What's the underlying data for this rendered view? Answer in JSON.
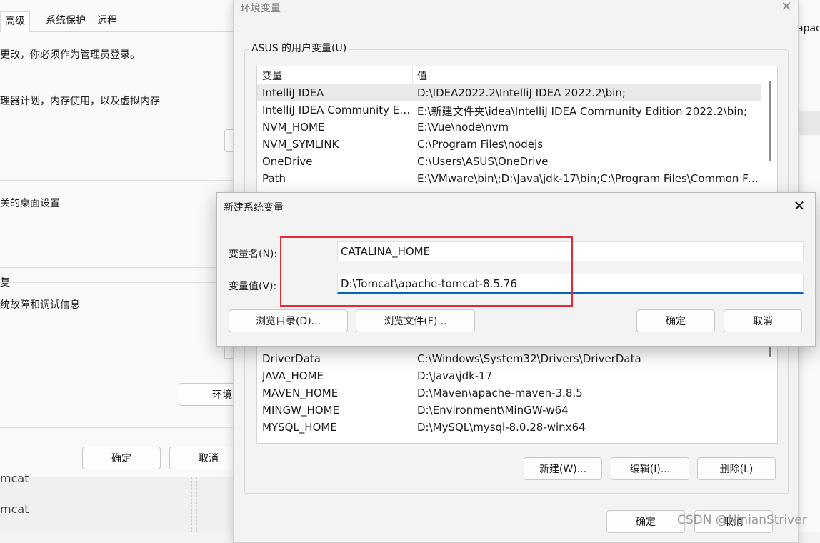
{
  "system_properties": {
    "tabs": [
      "高级",
      "系统保护",
      "远程"
    ],
    "admin_notice": "更改，你必须作为管理员登录。",
    "performance_desc": "理器计划，内存使用，以及虚拟内存",
    "profiles_desc": "关的桌面设置",
    "startup_heading": "复",
    "startup_desc": "统故障和调试信息",
    "env_button": "环境",
    "ok_button": "确定",
    "cancel_button": "取消"
  },
  "bottom_strip": {
    "line1": "mcat",
    "line2": "mcat"
  },
  "right_fragment": {
    "text": "apac"
  },
  "env_window": {
    "title": "环境变量",
    "user_group_label": "ASUS 的用户变量(U)",
    "columns": [
      "变量",
      "值"
    ],
    "user_vars": [
      {
        "name": "IntelliJ IDEA",
        "value": "D:\\IDEA2022.2\\IntelliJ IDEA 2022.2\\bin;"
      },
      {
        "name": "IntelliJ IDEA Community Ed...",
        "value": "E:\\新建文件夹\\idea\\IntelliJ IDEA Community Edition 2022.2\\bin;"
      },
      {
        "name": "NVM_HOME",
        "value": "E:\\Vue\\node\\nvm"
      },
      {
        "name": "NVM_SYMLINK",
        "value": "C:\\Program Files\\nodejs"
      },
      {
        "name": "OneDrive",
        "value": "C:\\Users\\ASUS\\OneDrive"
      },
      {
        "name": "Path",
        "value": "E:\\VMware\\bin\\;D:\\Java\\jdk-17\\bin;C:\\Program Files\\Common Fi..."
      }
    ],
    "system_vars": [
      {
        "name": "DriverData",
        "value": "C:\\Windows\\System32\\Drivers\\DriverData"
      },
      {
        "name": "JAVA_HOME",
        "value": "D:\\Java\\jdk-17"
      },
      {
        "name": "MAVEN_HOME",
        "value": "D:\\Maven\\apache-maven-3.8.5"
      },
      {
        "name": "MINGW_HOME",
        "value": "D:\\Environment\\MinGW-w64"
      },
      {
        "name": "MYSQL_HOME",
        "value": "D:\\MySQL\\mysql-8.0.28-winx64"
      }
    ],
    "new_button": "新建(W)...",
    "edit_button": "编辑(I)...",
    "delete_button": "删除(L)",
    "ok_button": "确定",
    "cancel_button": "取消"
  },
  "new_var_dialog": {
    "title": "新建系统变量",
    "name_label": "变量名(N):",
    "value_label": "变量值(V):",
    "name_value": "CATALINA_HOME",
    "value_value": "D:\\Tomcat\\apache-tomcat-8.5.76",
    "browse_dir_button": "浏览目录(D)...",
    "browse_file_button": "浏览文件(F)...",
    "ok_button": "确定",
    "cancel_button": "取消",
    "highlight_color": "#e5283a",
    "focus_color": "#0067c0"
  },
  "watermark": "CSDN @NinianStriver"
}
